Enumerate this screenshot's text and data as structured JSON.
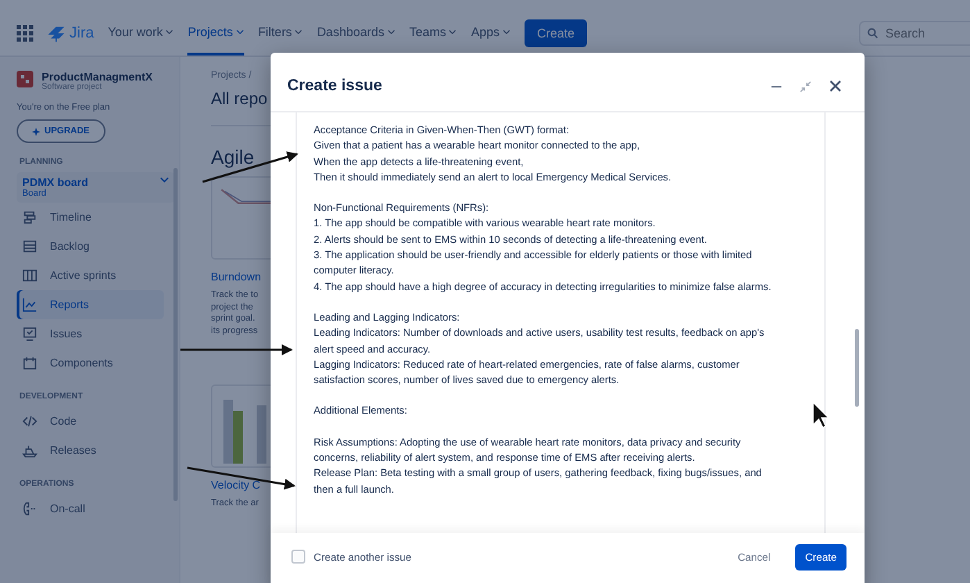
{
  "nav": {
    "product": "Jira",
    "items": [
      {
        "label": "Your work",
        "selected": false
      },
      {
        "label": "Projects",
        "selected": true
      },
      {
        "label": "Filters",
        "selected": false
      },
      {
        "label": "Dashboards",
        "selected": false
      },
      {
        "label": "Teams",
        "selected": false
      },
      {
        "label": "Apps",
        "selected": false
      }
    ],
    "create": "Create",
    "search": {
      "placeholder": "Search"
    }
  },
  "sidebar": {
    "project": {
      "name": "ProductManagmentX",
      "type": "Software project"
    },
    "plan_note": "You're on the Free plan",
    "upgrade": "UPGRADE",
    "sections": [
      {
        "heading": "PLANNING",
        "board": {
          "name": "PDMX board",
          "sub": "Board"
        },
        "items": [
          {
            "label": "Timeline",
            "selected": false
          },
          {
            "label": "Backlog",
            "selected": false
          },
          {
            "label": "Active sprints",
            "selected": false
          },
          {
            "label": "Reports",
            "selected": true
          },
          {
            "label": "Issues",
            "selected": false
          },
          {
            "label": "Components",
            "selected": false
          }
        ]
      },
      {
        "heading": "DEVELOPMENT",
        "items": [
          {
            "label": "Code",
            "selected": false
          },
          {
            "label": "Releases",
            "selected": false
          }
        ]
      },
      {
        "heading": "OPERATIONS",
        "items": [
          {
            "label": "On-call",
            "selected": false
          }
        ]
      }
    ]
  },
  "main": {
    "breadcrumb": "Projects /",
    "title": "All repo",
    "section": "Agile",
    "cards": [
      {
        "kind": "line",
        "link": "Burndown",
        "desc": [
          "Track the to",
          "project the",
          "sprint goal.",
          "its progress"
        ]
      },
      {
        "kind": "bar",
        "link": "Velocity C",
        "desc": [
          "Track the ar"
        ]
      }
    ]
  },
  "modal": {
    "title": "Create issue",
    "paragraphs": [
      [
        "Acceptance Criteria in Given-When-Then (GWT) format:",
        "Given that a patient has a wearable heart monitor connected to the app,",
        "When the app detects a life-threatening event,",
        "Then it should immediately send an alert to local Emergency Medical Services."
      ],
      [
        "Non-Functional Requirements (NFRs):",
        "1. The app should be compatible with various wearable heart rate monitors.",
        "2. Alerts should be sent to EMS within 10 seconds of detecting a life-threatening event.",
        "3. The application should be user-friendly and accessible for elderly patients or those with limited computer literacy.",
        "4. The app should have a high degree of accuracy in detecting irregularities to minimize false alarms."
      ],
      [
        "Leading and Lagging Indicators:",
        "Leading Indicators: Number of downloads and active users, usability test results, feedback on app's alert speed and accuracy.",
        "Lagging Indicators: Reduced rate of heart-related emergencies, rate of false alarms, customer satisfaction scores, number of lives saved due to emergency alerts."
      ],
      [
        "Additional Elements:"
      ],
      [
        "Risk Assumptions: Adopting the use of wearable heart rate monitors, data privacy and security concerns, reliability of alert system, and response time of EMS after receiving alerts.",
        "Release Plan: Beta testing with a small group of users, gathering feedback, fixing bugs/issues, and then a full launch."
      ]
    ],
    "another": {
      "label": "Create another issue",
      "checked": false
    },
    "cancel": "Cancel",
    "create": "Create"
  }
}
